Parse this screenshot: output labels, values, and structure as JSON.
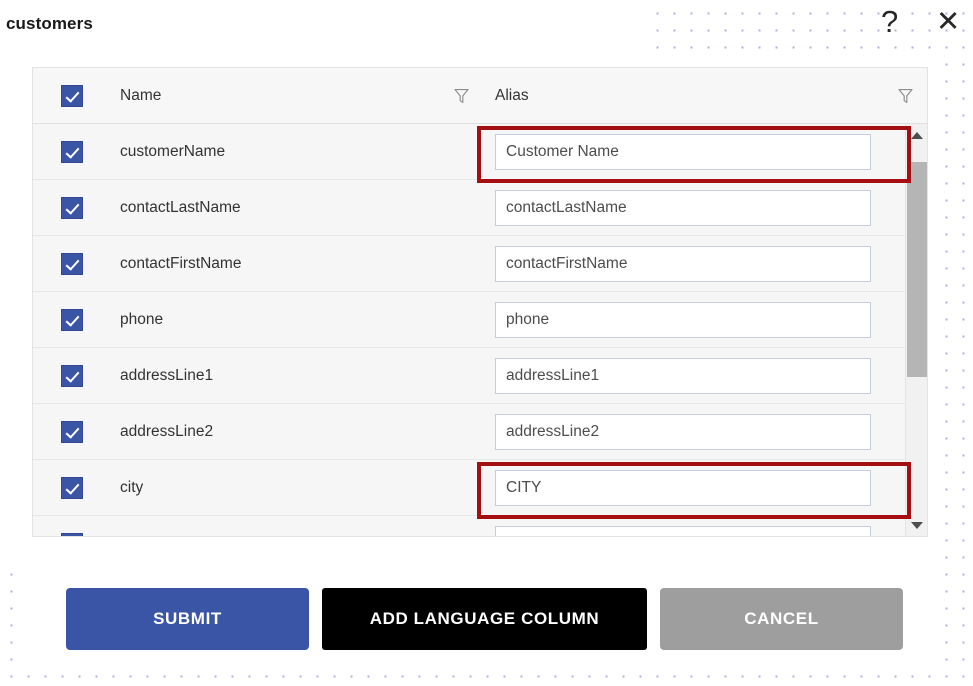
{
  "dialog": {
    "title": "customers",
    "help_icon": "?",
    "close_icon": "✕"
  },
  "grid": {
    "columns": [
      {
        "key": "name",
        "label": "Name",
        "filter_icon": "funnel-icon"
      },
      {
        "key": "alias",
        "label": "Alias",
        "filter_icon": "funnel-icon"
      }
    ],
    "header_checkbox_checked": true,
    "rows": [
      {
        "checked": true,
        "name": "customerName",
        "alias": "Customer Name",
        "highlighted": true
      },
      {
        "checked": true,
        "name": "contactLastName",
        "alias": "contactLastName",
        "highlighted": false
      },
      {
        "checked": true,
        "name": "contactFirstName",
        "alias": "contactFirstName",
        "highlighted": false
      },
      {
        "checked": true,
        "name": "phone",
        "alias": "phone",
        "highlighted": false
      },
      {
        "checked": true,
        "name": "addressLine1",
        "alias": "addressLine1",
        "highlighted": false
      },
      {
        "checked": true,
        "name": "addressLine2",
        "alias": "addressLine2",
        "highlighted": false
      },
      {
        "checked": true,
        "name": "city",
        "alias": "CITY",
        "highlighted": true
      },
      {
        "checked": true,
        "name": "",
        "alias": "",
        "highlighted": false
      }
    ],
    "scrollbar": {
      "up_arrow": "scroll-up-icon",
      "down_arrow": "scroll-down-icon"
    }
  },
  "footer": {
    "submit_label": "SUBMIT",
    "add_language_column_label": "ADD LANGUAGE COLUMN",
    "cancel_label": "CANCEL"
  },
  "colors": {
    "accent_blue": "#3a55a5",
    "annotation_red": "#a50f12",
    "cancel_gray": "#9e9e9e",
    "add_language_black": "#000000",
    "row_background": "#f6f6f6"
  }
}
